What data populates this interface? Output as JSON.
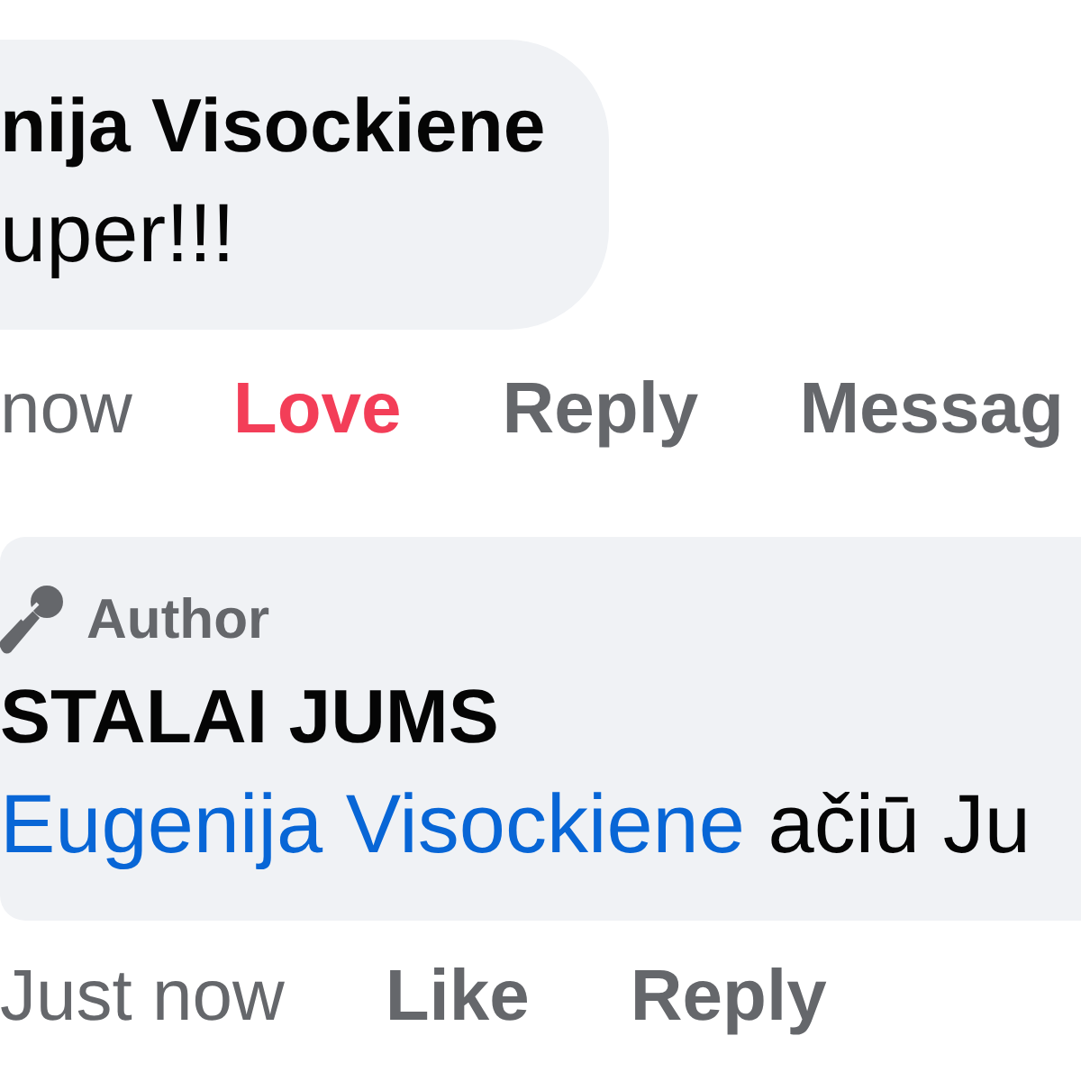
{
  "comments": [
    {
      "author": "nija Visockiene",
      "text": "uper!!!",
      "actions": [
        {
          "kind": "time",
          "label": "now"
        },
        {
          "kind": "reaction",
          "label": "Love",
          "selected": true
        },
        {
          "kind": "action",
          "label": "Reply"
        },
        {
          "kind": "action",
          "label": "Messag"
        }
      ]
    },
    {
      "badge": "Author",
      "author": "STALAI JUMS",
      "mention": "Eugenija Visockiene",
      "text": "ačiū Ju",
      "actions": [
        {
          "kind": "time",
          "label": "Just now"
        },
        {
          "kind": "reaction",
          "label": "Like",
          "selected": false
        },
        {
          "kind": "action",
          "label": "Reply"
        }
      ]
    }
  ]
}
